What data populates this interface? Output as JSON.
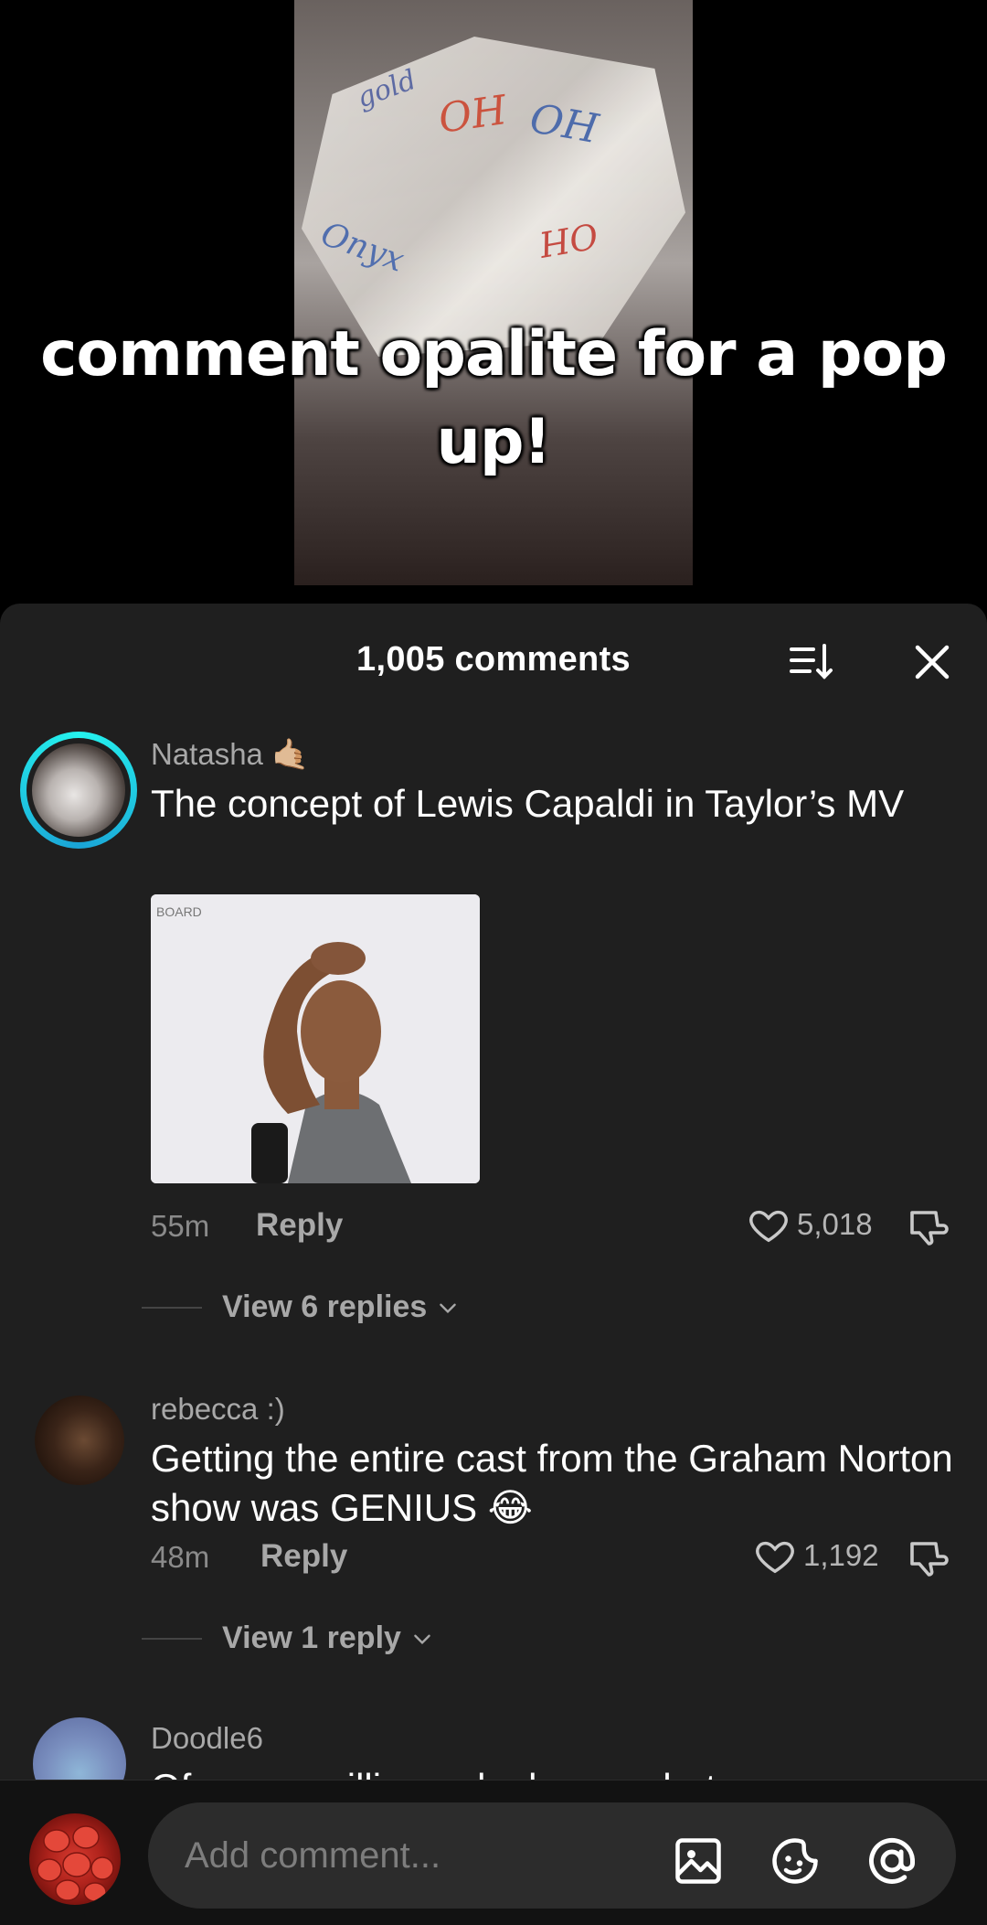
{
  "video": {
    "caption": "comment opalite for a pop up!"
  },
  "sheet": {
    "count_label": "1,005 comments",
    "sort_icon": "sort-icon",
    "close_icon": "close-icon"
  },
  "comments": [
    {
      "username": "Natasha 🤙🏼",
      "text": "The concept of Lewis Capaldi in Taylor’s MV",
      "time": "55m",
      "reply_label": "Reply",
      "likes": "5,018",
      "view_replies": "View 6 replies"
    },
    {
      "username": "rebecca :)",
      "text": "Getting the entire cast from the Graham Norton show was GENIUS 😂",
      "time": "48m",
      "reply_label": "Reply",
      "likes": "1,192",
      "view_replies": "View 1 reply"
    },
    {
      "username": "Doodle6",
      "text": "Of course cillian only does a photo"
    }
  ],
  "composer": {
    "placeholder": "Add comment...",
    "icons": [
      "image-icon",
      "emoji-icon",
      "mention-icon"
    ]
  },
  "colors": {
    "sheet_bg": "#1f1f1f",
    "accent_ring": "#25f4ee"
  }
}
